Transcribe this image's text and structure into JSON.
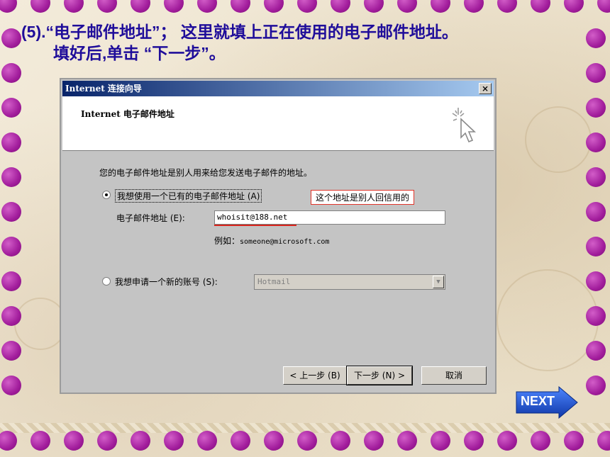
{
  "slide": {
    "heading_line1": "(5).“电子邮件地址”；  这里就填上正在使用的电子邮件地址。",
    "heading_line2": "填好后,单击 “下一步”。",
    "next_label": "NEXT"
  },
  "window": {
    "title": "Internet 连接向导",
    "close_glyph": "×",
    "header_title": "Internet 电子邮件地址",
    "description": "您的电子邮件地址是别人用来给您发送电子邮件的地址。",
    "option1_label": "我想使用一个已有的电子邮件地址 (A)",
    "option1_selected": true,
    "callout": "这个地址是别人回信用的",
    "email_label": "电子邮件地址 (E):",
    "email_value": "whoisit@188.net",
    "example_label": "例如：",
    "example_value": "someone@microsoft.com",
    "option2_label": "我想申请一个新的账号 (S):",
    "option2_selected": false,
    "provider_value": "Hotmail",
    "buttons": {
      "back": "< 上一步 (B)",
      "next": "下一步 (N) >",
      "cancel": "取消"
    }
  },
  "colors": {
    "heading": "#1f0d9a",
    "dot": "#a21d9c",
    "titlebar": "#08246a",
    "callout_border": "#e0352a",
    "next_button": "#1a4fc4"
  }
}
